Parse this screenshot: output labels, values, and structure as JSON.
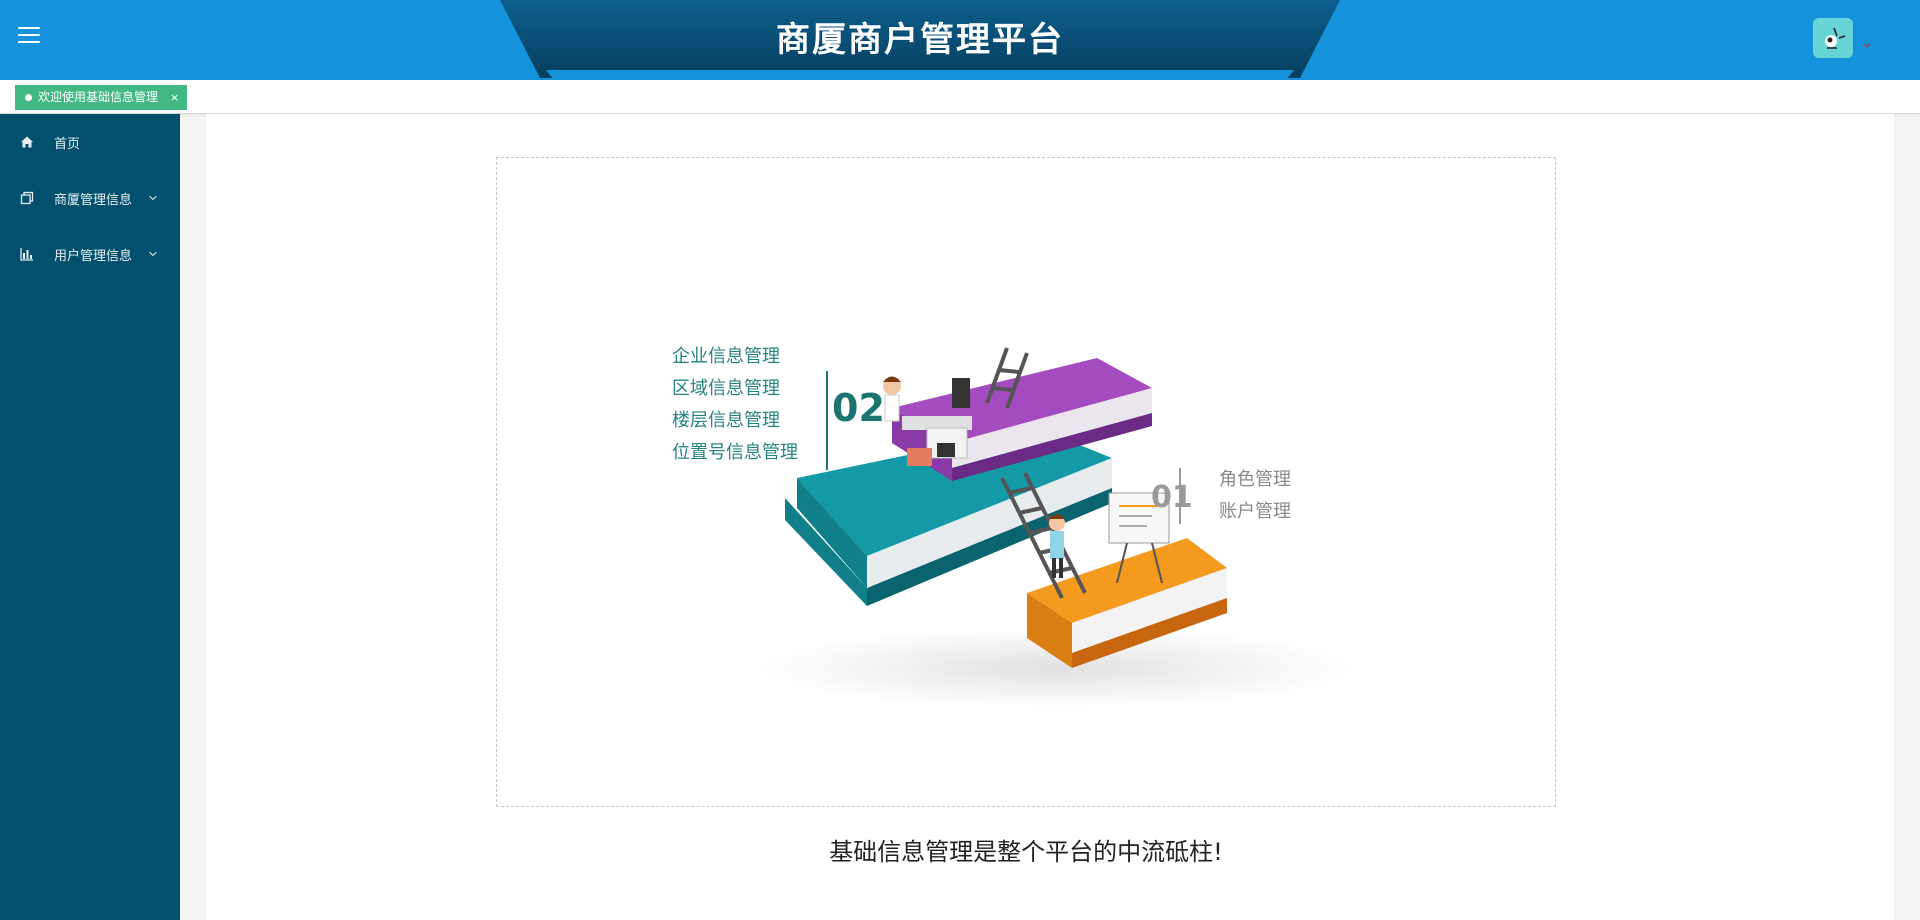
{
  "header": {
    "title": "商厦商户管理平台",
    "menu_toggle_icon": "hamburger-menu-icon",
    "avatar_icon": "user-avatar-icon",
    "dropdown_icon": "caret-down-icon",
    "colors": {
      "bar": "#1592dc",
      "banner": "#0b4f79"
    }
  },
  "tabs": [
    {
      "label": "欢迎使用基础信息管理",
      "close": "×",
      "active": true
    }
  ],
  "sidebar": {
    "items": [
      {
        "label": "首页",
        "icon": "home-icon",
        "expandable": false
      },
      {
        "label": "商厦管理信息",
        "icon": "copy-icon",
        "expandable": true
      },
      {
        "label": "用户管理信息",
        "icon": "bar-chart-icon",
        "expandable": true
      }
    ],
    "colors": {
      "bg": "#02506d"
    }
  },
  "main": {
    "illustration": {
      "group_02": {
        "number": "02",
        "items": [
          "企业信息管理",
          "区域信息管理",
          "楼层信息管理",
          "位置号信息管理"
        ]
      },
      "group_01": {
        "number": "01",
        "items": [
          "角色管理",
          "账户管理"
        ]
      }
    },
    "caption": "基础信息管理是整个平台的中流砥柱!"
  }
}
